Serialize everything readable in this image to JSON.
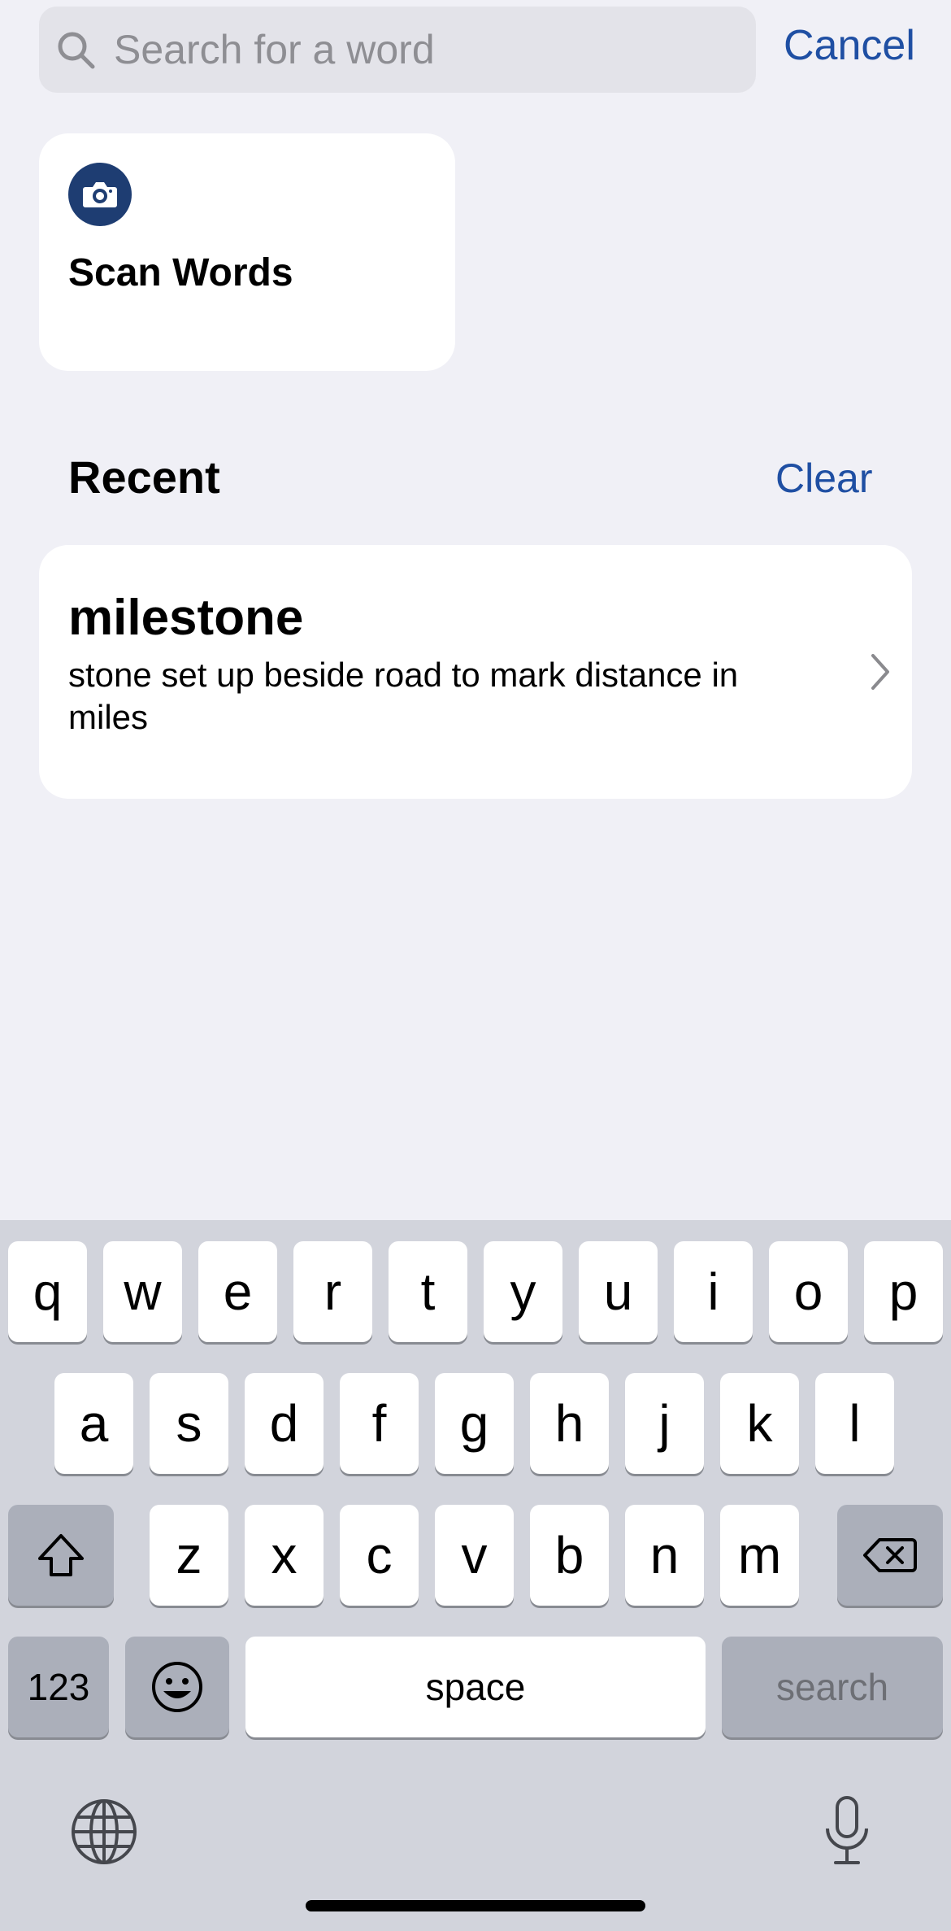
{
  "search": {
    "placeholder": "Search for a word",
    "value": "",
    "cancel_label": "Cancel"
  },
  "scan_card": {
    "label": "Scan Words",
    "icon": "camera-icon"
  },
  "recent": {
    "heading": "Recent",
    "clear_label": "Clear",
    "items": [
      {
        "word": "milestone",
        "definition": "stone set up beside road to mark distance in miles"
      }
    ]
  },
  "keyboard": {
    "row1": [
      "q",
      "w",
      "e",
      "r",
      "t",
      "y",
      "u",
      "i",
      "o",
      "p"
    ],
    "row2": [
      "a",
      "s",
      "d",
      "f",
      "g",
      "h",
      "j",
      "k",
      "l"
    ],
    "row3": [
      "z",
      "x",
      "c",
      "v",
      "b",
      "n",
      "m"
    ],
    "numbers_label": "123",
    "space_label": "space",
    "search_label": "search",
    "icons": [
      "shift-icon",
      "delete-icon",
      "emoji-icon",
      "globe-icon",
      "microphone-icon"
    ]
  },
  "colors": {
    "accent": "#1f4fa3",
    "background": "#f0f0f6",
    "camera_badge": "#1e3d72",
    "keyboard_bg": "#d2d4dc"
  }
}
